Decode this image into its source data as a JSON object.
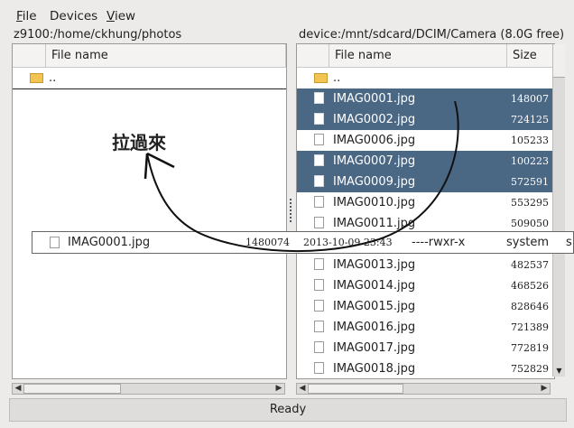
{
  "menu": {
    "file": "File",
    "file_key": "F",
    "file_rest": "ile",
    "devices": "Devices",
    "view": "View",
    "view_key": "V",
    "view_rest": "iew"
  },
  "left": {
    "path": "z9100:/home/ckhung/photos",
    "col_name": "File name",
    "parent": ".."
  },
  "right": {
    "path": "device:/mnt/sdcard/DCIM/Camera (8.0G free)",
    "col_name": "File name",
    "col_size": "Size",
    "parent": "..",
    "files": [
      {
        "name": "IMAG0001.jpg",
        "size": "148007",
        "selected": true
      },
      {
        "name": "IMAG0002.jpg",
        "size": "724125",
        "selected": true
      },
      {
        "name": "IMAG0006.jpg",
        "size": "105233",
        "selected": false
      },
      {
        "name": "IMAG0007.jpg",
        "size": "100223",
        "selected": true
      },
      {
        "name": "IMAG0009.jpg",
        "size": "572591",
        "selected": true
      },
      {
        "name": "IMAG0010.jpg",
        "size": "553295",
        "selected": false
      },
      {
        "name": "IMAG0011.jpg",
        "size": "509050",
        "selected": false
      },
      {
        "name": "",
        "size": "",
        "selected": false
      },
      {
        "name": "IMAG0013.jpg",
        "size": "482537",
        "selected": false
      },
      {
        "name": "IMAG0014.jpg",
        "size": "468526",
        "selected": false
      },
      {
        "name": "IMAG0015.jpg",
        "size": "828646",
        "selected": false
      },
      {
        "name": "IMAG0016.jpg",
        "size": "721389",
        "selected": false
      },
      {
        "name": "IMAG0017.jpg",
        "size": "772819",
        "selected": false
      },
      {
        "name": "IMAG0018.jpg",
        "size": "752829",
        "selected": false
      }
    ]
  },
  "drag": {
    "name": "IMAG0001.jpg",
    "size": "1480074",
    "date": "2013-10-09 23:43",
    "perms": "----rwxr-x",
    "owner": "system",
    "group": "s"
  },
  "annotation": "拉過來",
  "status": "Ready",
  "colors": {
    "selection": "#4a6784",
    "folder": "#f2c452"
  }
}
